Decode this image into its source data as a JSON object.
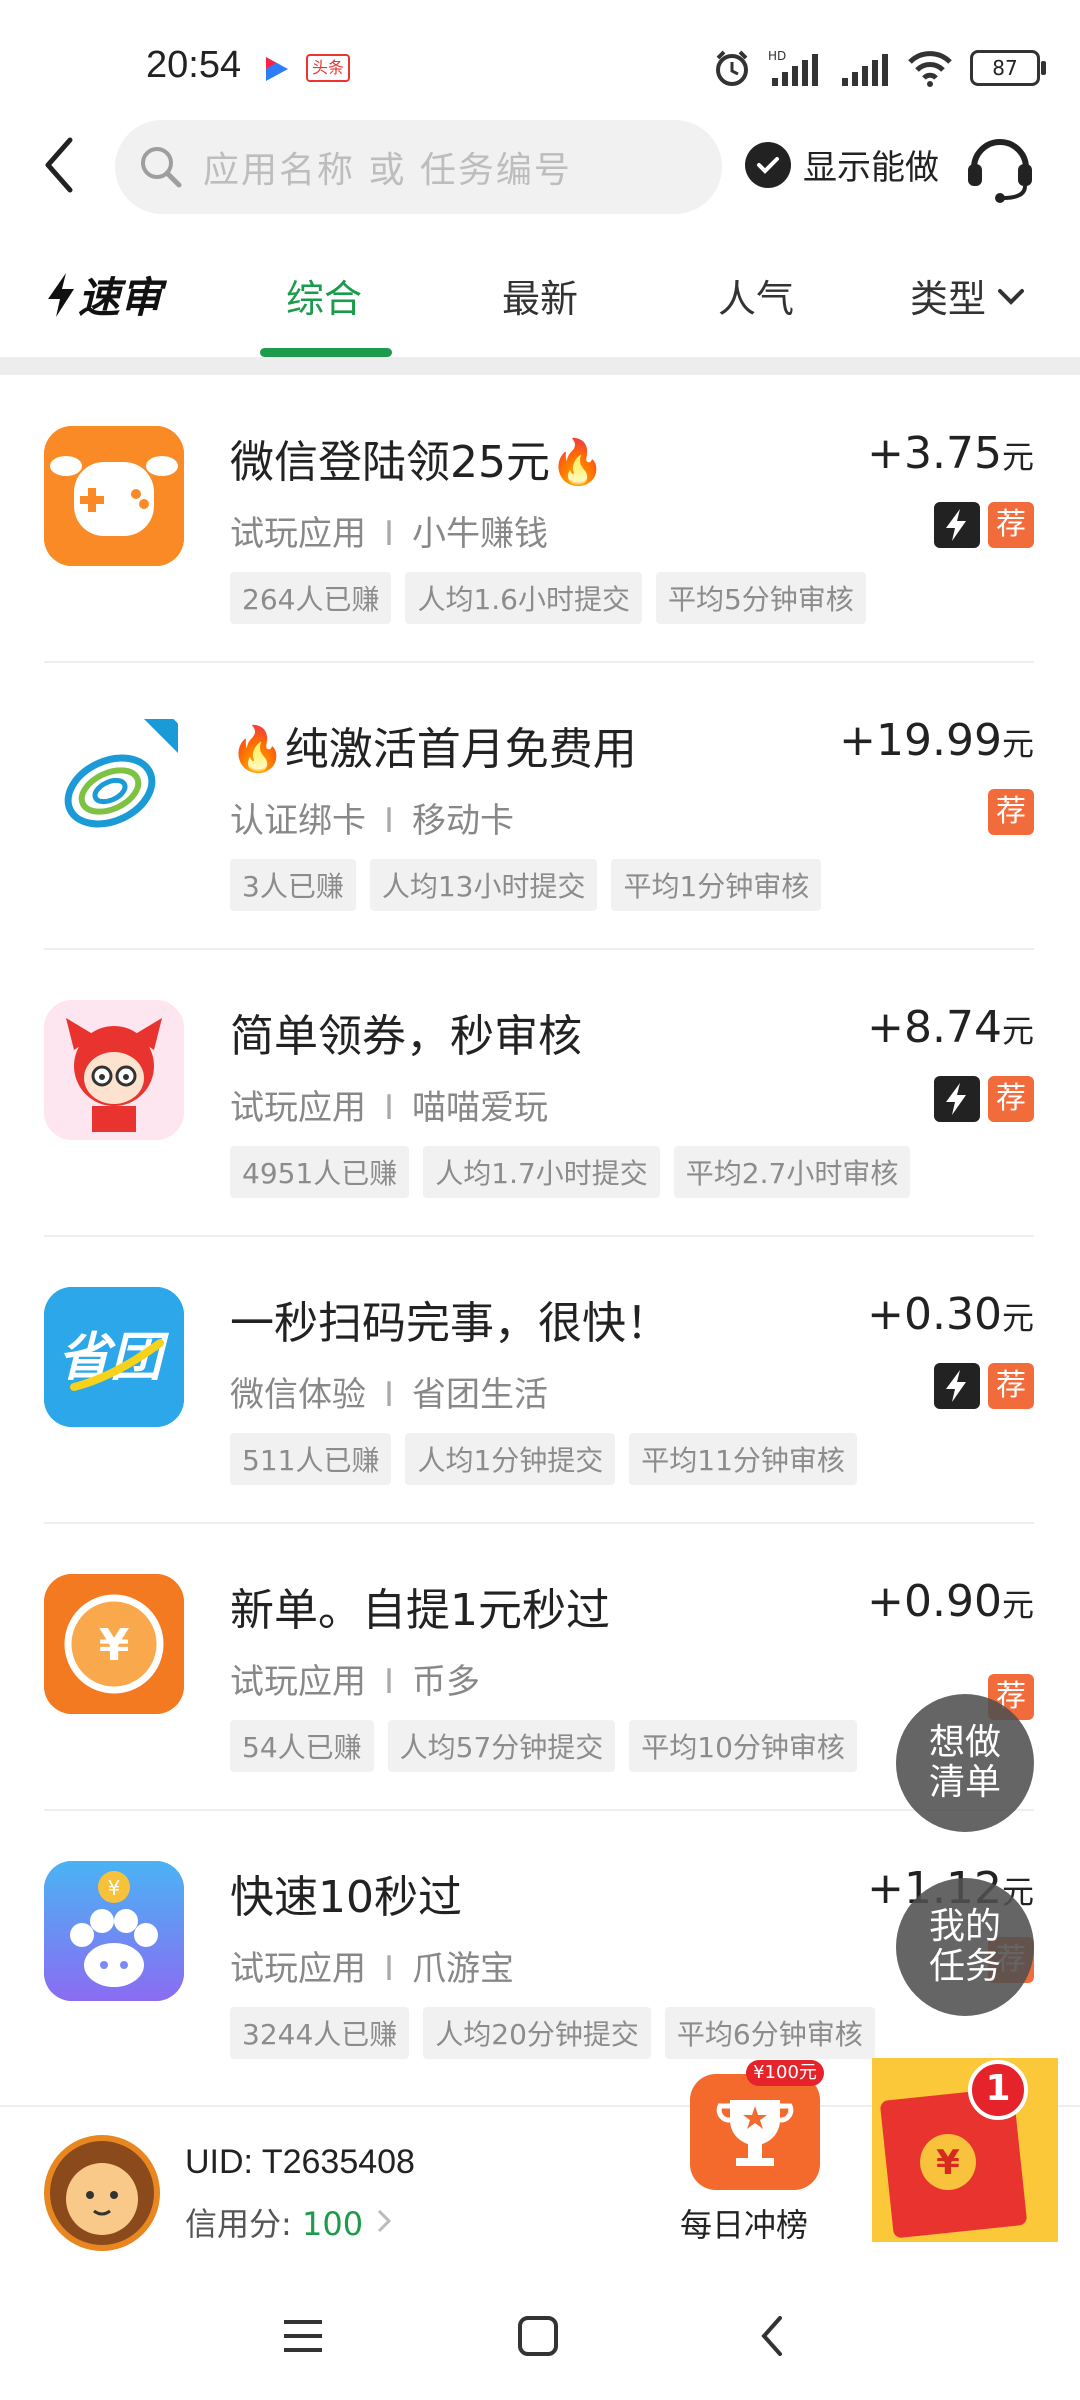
{
  "status_bar": {
    "time": "20:54",
    "app_badge": "头条",
    "battery": "87"
  },
  "search": {
    "placeholder": "应用名称 或 任务编号",
    "show_can_do_label": "显示能做"
  },
  "tabs": {
    "brand": "速审",
    "items": [
      {
        "label": "综合",
        "active": true
      },
      {
        "label": "最新",
        "active": false
      },
      {
        "label": "人气",
        "active": false
      },
      {
        "label": "类型",
        "active": false
      }
    ]
  },
  "tasks": [
    {
      "title": "微信登陆领25元🔥",
      "category": "试玩应用",
      "app": "小牛赚钱",
      "stats": [
        "264人已赚",
        "人均1.6小时提交",
        "平均5分钟审核"
      ],
      "price": "+3.75",
      "unit": "元",
      "fast": true,
      "recommended": "荐",
      "icon": "cow-icon"
    },
    {
      "title": "🔥纯激活首月免费用",
      "category": "认证绑卡",
      "app": "移动卡",
      "stats": [
        "3人已赚",
        "人均13小时提交",
        "平均1分钟审核"
      ],
      "price": "+19.99",
      "unit": "元",
      "fast": false,
      "recommended": "荐",
      "icon": "china-mobile-icon"
    },
    {
      "title": "简单领券，秒审核",
      "category": "试玩应用",
      "app": "喵喵爱玩",
      "stats": [
        "4951人已赚",
        "人均1.7小时提交",
        "平均2.7小时审核"
      ],
      "price": "+8.74",
      "unit": "元",
      "fast": true,
      "recommended": "荐",
      "icon": "cat-girl-icon"
    },
    {
      "title": "一秒扫码完事，很快！",
      "category": "微信体验",
      "app": "省团生活",
      "stats": [
        "511人已赚",
        "人均1分钟提交",
        "平均11分钟审核"
      ],
      "price": "+0.30",
      "unit": "元",
      "fast": true,
      "recommended": "荐",
      "icon": "shengtuan-icon"
    },
    {
      "title": "新单。自提1元秒过",
      "category": "试玩应用",
      "app": "币多",
      "stats": [
        "54人已赚",
        "人均57分钟提交",
        "平均10分钟审核"
      ],
      "price": "+0.90",
      "unit": "元",
      "fast": false,
      "recommended": "荐",
      "icon": "yen-coin-icon"
    },
    {
      "title": "快速10秒过",
      "category": "试玩应用",
      "app": "爪游宝",
      "stats": [
        "3244人已赚",
        "人均20分钟提交",
        "平均6分钟审核"
      ],
      "price": "+1.12",
      "unit": "元",
      "fast": false,
      "recommended": "荐",
      "icon": "paw-icon"
    }
  ],
  "floating": {
    "wish_list": "想做\n清单",
    "my_tasks": "我的\n任务"
  },
  "user": {
    "uid": "UID: T2635408",
    "credit_label": "信用分: ",
    "credit_score": "100"
  },
  "daily_rank": {
    "label": "每日冲榜",
    "prize": "¥100元"
  },
  "red_packet": {
    "count": "1"
  }
}
